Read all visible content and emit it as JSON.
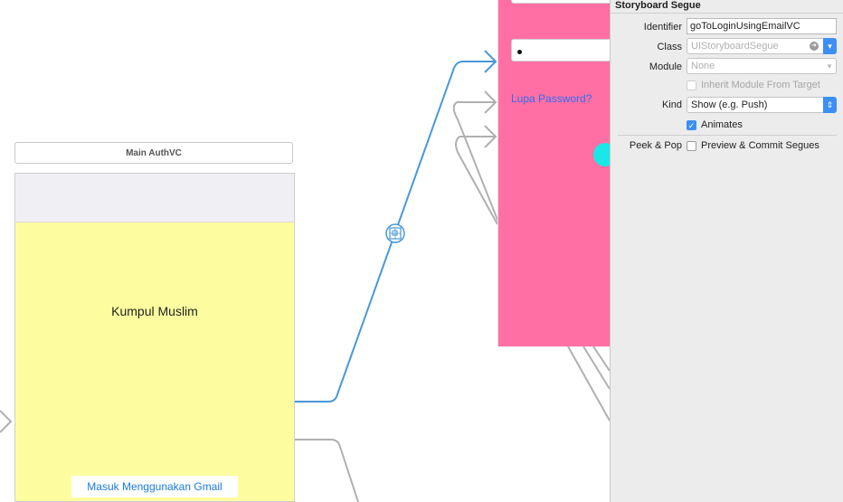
{
  "canvas": {
    "main_scene": {
      "title": "Main AuthVC",
      "app_title": "Kumpul Muslim",
      "gmail_button": "Masuk Menggunakan Gmail"
    },
    "login_scene": {
      "password_value": "•",
      "forgot_password_link": "Lupa Password?"
    }
  },
  "inspector": {
    "section_title": "Storyboard Segue",
    "identifier": {
      "label": "Identifier",
      "value": "goToLoginUsingEmailVC"
    },
    "class": {
      "label": "Class",
      "placeholder": "UIStoryboardSegue"
    },
    "module": {
      "label": "Module",
      "placeholder": "None"
    },
    "inherit_module": {
      "label": "Inherit Module From Target",
      "checked": false
    },
    "kind": {
      "label": "Kind",
      "value": "Show (e.g. Push)"
    },
    "animates": {
      "label": "Animates",
      "checked": true
    },
    "peek_pop": {
      "label": "Peek & Pop",
      "option_label": "Preview & Commit Segues",
      "checked": false
    }
  },
  "colors": {
    "selected_segue": "#4a97d8",
    "segue": "#b0b0b0",
    "main_scene_bg": "#fdfd9f",
    "login_scene_bg": "#ff6fa3",
    "accent": "#3d8ff5"
  }
}
